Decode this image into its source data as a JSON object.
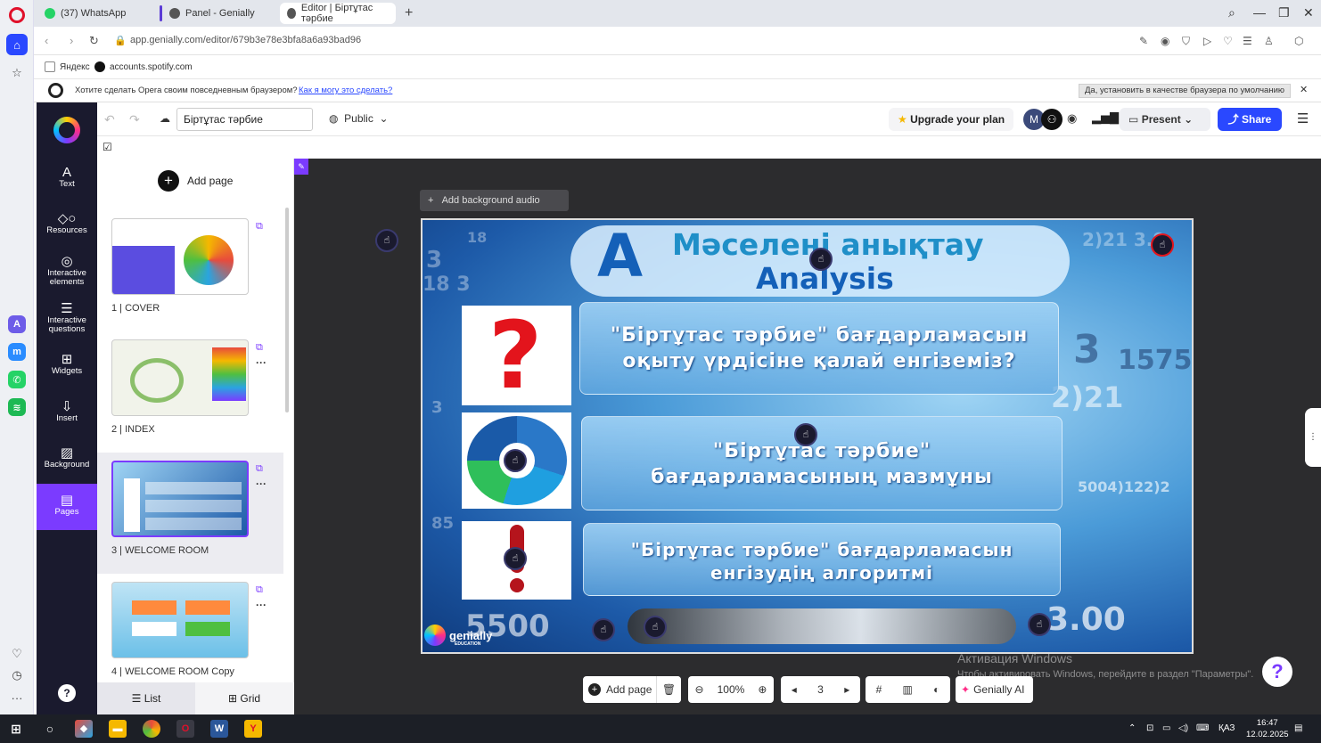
{
  "browser": {
    "tabs": [
      {
        "label": "(37) WhatsApp",
        "color": "#25d366"
      },
      {
        "label": "Panel - Genially",
        "color": "#555555"
      },
      {
        "label": "Editor | Біртұтас тәрбие",
        "color": "#555555"
      }
    ],
    "url": "app.genially.com/editor/679b3e78e3bfa8a6a93bad96",
    "bookmarks": [
      {
        "label": "Яндекс",
        "color": "#ffffff"
      },
      {
        "label": "accounts.spotify.com",
        "color": "#111111"
      }
    ],
    "infobar": {
      "message": "Хотите сделать Opera своим повседневным браузером?",
      "link": "Как я могу это сделать?",
      "button": "Да, установить в качестве браузера по умолчанию"
    }
  },
  "rail": {
    "items": [
      {
        "label": "Text",
        "glyph": "A"
      },
      {
        "label": "Resources",
        "glyph": "◇○"
      },
      {
        "label": "Interactive elements",
        "glyph": "◎"
      },
      {
        "label": "Interactive questions",
        "glyph": "☰"
      },
      {
        "label": "Widgets",
        "glyph": "⊞"
      },
      {
        "label": "Insert",
        "glyph": "⇩"
      },
      {
        "label": "Background",
        "glyph": "▨"
      },
      {
        "label": "Pages",
        "glyph": "▤"
      }
    ],
    "help": "?"
  },
  "topbar": {
    "title": "Біртұтас тәрбие",
    "visibility": "Public",
    "upgrade": "Upgrade your plan",
    "avatar": "M",
    "present": "Present",
    "share": "Share"
  },
  "pages_panel": {
    "add_page": "Add page",
    "pages": [
      {
        "label": "1 |  COVER"
      },
      {
        "label": "2 |  INDEX"
      },
      {
        "label": "3 |  WELCOME ROOM"
      },
      {
        "label": "4 |  WELCOME ROOM Copy"
      }
    ],
    "view_list": "List",
    "view_grid": "Grid"
  },
  "canvas": {
    "bg_audio": "Add background audio",
    "slide": {
      "letter": "A",
      "title_line1": "Мәселені анықтау",
      "title_line2": "Analysis",
      "panels": [
        {
          "line1": "\"Біртұтас тәрбие\" бағдарламасын",
          "line2": "оқыту үрдісіне қалай енгіземіз?"
        },
        {
          "line1": "\"Біртұтас тәрбие\"",
          "line2": "бағдарламасының мазмұны"
        },
        {
          "line1": "\"Біртұтас тәрбие\" бағдарламасын",
          "line2": "енгізудің алгоритмі"
        }
      ],
      "logo_text": "genially",
      "logo_sub": "EDUCATION"
    },
    "watermark_title": "Активация Windows",
    "watermark_sub": "Чтобы активировать Windows, перейдите в раздел \"Параметры\"."
  },
  "bottom_toolbar": {
    "add_page": "Add page",
    "zoom": "100%",
    "page_number": "3",
    "ai": "Genially AI"
  },
  "taskbar": {
    "lang": "ҚАЗ",
    "time": "16:47",
    "date": "12.02.2025"
  }
}
